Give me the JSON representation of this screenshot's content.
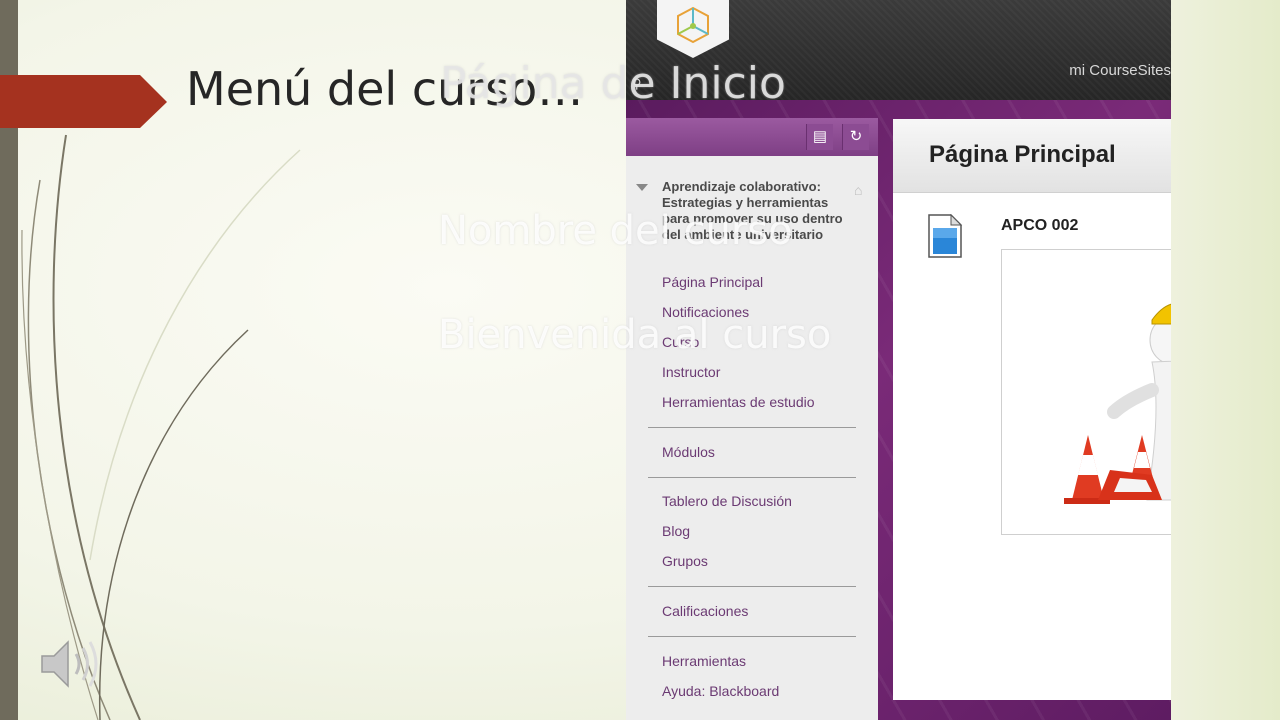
{
  "slide": {
    "title": "Menú del curso…",
    "ghost_labels": [
      "Página de Inicio",
      "Nombre del curso",
      "Bienvenida al curso"
    ]
  },
  "top_bar": {
    "my_coursesites": "mi CourseSites"
  },
  "course_menu": {
    "course_title": "Aprendizaje colaborativo: Estrategias y herramientas para promover su uso dentro del ambiente universitario",
    "group1": [
      "Página Principal",
      "Notificaciones",
      "Curso",
      "Instructor",
      "Herramientas de estudio"
    ],
    "group2": [
      "Módulos"
    ],
    "group3": [
      "Tablero de Discusión",
      "Blog",
      "Grupos"
    ],
    "group4": [
      "Calificaciones"
    ],
    "group5": [
      "Herramientas",
      "Ayuda: Blackboard"
    ]
  },
  "content": {
    "page_title": "Página Principal",
    "item_title": "APCO 002"
  },
  "icons": [
    "speaker-icon",
    "folder-icon",
    "refresh-icon",
    "home-icon",
    "link-icon",
    "document-icon",
    "coursesites-logo-icon"
  ],
  "colors": {
    "title_arrow": "#a5321f",
    "menu_link": "#6b3a73",
    "purple_bg": "#6e2470"
  }
}
